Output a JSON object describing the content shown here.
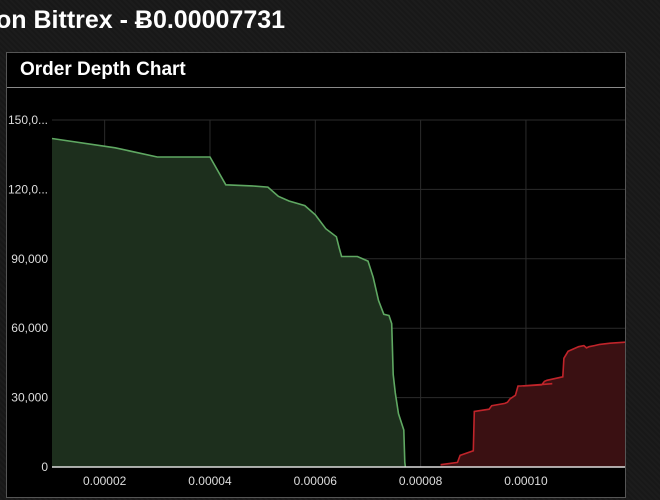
{
  "page": {
    "title": "on Bittrex - Ƀ0.00007731"
  },
  "panel": {
    "title": "Order Depth Chart"
  },
  "colors": {
    "bid_line": "#5fa862",
    "bid_fill": "#1d2f1d",
    "ask_line": "#c0242a",
    "ask_fill": "#3a1012",
    "grid": "#2b2b2b"
  },
  "chart_data": {
    "type": "area",
    "title": "",
    "xlabel": "",
    "ylabel": "",
    "xlim": [
      1e-05,
      0.000119
    ],
    "ylim": [
      0,
      150000
    ],
    "x_ticks": [
      2e-05,
      4e-05,
      6e-05,
      8e-05,
      0.0001
    ],
    "x_tick_labels": [
      "0.00002",
      "0.00004",
      "0.00006",
      "0.00008",
      "0.00010"
    ],
    "y_ticks": [
      0,
      30000,
      60000,
      90000,
      120000,
      150000
    ],
    "y_tick_labels": [
      "0",
      "30,000",
      "60,000",
      "90,000",
      "120,0...",
      "150,0..."
    ],
    "grid": true,
    "legend": "none",
    "series": [
      {
        "side": "bid",
        "x": [
          1e-05,
          2.2e-05,
          3e-05,
          3.8e-05,
          4e-05,
          4.3e-05,
          4.8e-05,
          5.1e-05,
          5.3e-05,
          5.5e-05,
          5.8e-05,
          6e-05,
          6.2e-05,
          6.4e-05,
          6.45e-05,
          6.5e-05,
          6.8e-05,
          7e-05,
          7.1e-05,
          7.2e-05,
          7.3e-05,
          7.4e-05,
          7.45e-05,
          7.48e-05,
          7.52e-05,
          7.58e-05,
          7.68e-05,
          7.7e-05,
          7.71e-05
        ],
        "y": [
          142000,
          138000,
          134000,
          134000,
          134000,
          122000,
          121500,
          121000,
          117000,
          115000,
          113000,
          109000,
          103000,
          99500,
          95000,
          91000,
          91000,
          89000,
          82000,
          72000,
          66000,
          65500,
          62000,
          40000,
          32000,
          23000,
          16000,
          2000,
          0
        ]
      },
      {
        "side": "ask",
        "x": [
          8.38e-05,
          8.7e-05,
          8.75e-05,
          9e-05,
          9.02e-05,
          9.3e-05,
          9.35e-05,
          9.6e-05,
          9.65e-05,
          9.7e-05,
          9.8e-05,
          9.85e-05,
          9.9e-05,
          0.000105,
          9.95e-05,
          0.000103,
          0.0001035,
          0.000104,
          0.000107,
          0.0001072,
          0.000108,
          0.000109,
          0.00011,
          0.000111,
          0.0001115,
          0.000112,
          0.000113,
          0.000114,
          0.000116,
          0.000119
        ],
        "y": [
          1000,
          2000,
          5000,
          7000,
          24000,
          25000,
          26500,
          27500,
          28000,
          29500,
          31000,
          35000,
          35000,
          36000,
          35000,
          35500,
          37000,
          37500,
          39000,
          47000,
          50000,
          51000,
          52000,
          52500,
          51500,
          52000,
          52500,
          53000,
          53500,
          54000
        ]
      }
    ]
  }
}
